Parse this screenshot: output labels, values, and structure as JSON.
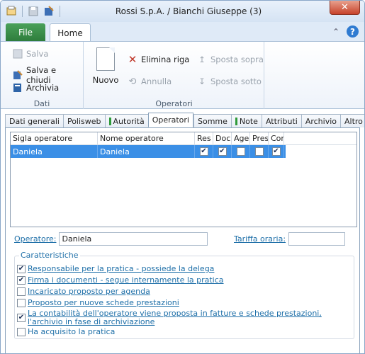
{
  "window": {
    "title": "Rossi S.p.A. / Bianchi Giuseppe (3)",
    "close_label": "✕"
  },
  "ribbon_tabs": {
    "file": "File",
    "home": "Home"
  },
  "ribbon": {
    "dati": {
      "label": "Dati",
      "salva": "Salva",
      "salva_chiudi": "Salva e chiudi",
      "archivia": "Archivia"
    },
    "operatori": {
      "label": "Operatori",
      "nuovo": "Nuovo",
      "elimina": "Elimina riga",
      "annulla": "Annulla",
      "sposta_sopra": "Sposta sopra",
      "sposta_sotto": "Sposta sotto"
    }
  },
  "tabs": [
    "Dati generali",
    "Polisweb",
    "Autorità",
    "Operatori",
    "Somme",
    "Note",
    "Attributi",
    "Archivio",
    "Altro"
  ],
  "grid": {
    "headers": [
      "Sigla operatore",
      "Nome operatore",
      "Res",
      "Doc",
      "Age",
      "Pres",
      "Con"
    ],
    "rows": [
      {
        "sigla": "Daniela",
        "nome": "Daniela",
        "checks": [
          true,
          true,
          false,
          false,
          true
        ]
      }
    ]
  },
  "form": {
    "operatore_label": "Operatore:",
    "operatore_value": "Daniela",
    "tariffa_label": "Tariffa oraria:",
    "tariffa_value": ""
  },
  "caratteristiche": {
    "legend": "Caratteristiche",
    "options": [
      {
        "label": "Responsabile per la pratica - possiede la delega",
        "checked": true
      },
      {
        "label": "Firma i documenti - segue internamente la pratica",
        "checked": true
      },
      {
        "label": "Incaricato proposto per agenda",
        "checked": false
      },
      {
        "label": "Proposto per nuove schede prestazioni",
        "checked": false
      },
      {
        "label": "La contabilità dell'operatore viene proposta in fatture e schede prestazioni, l'archivio in fase di archiviazione",
        "checked": true
      },
      {
        "label": "Ha acquisito la pratica",
        "checked": false
      }
    ]
  },
  "colors": {
    "accent": "#3b8fe6",
    "file_tab": "#2e7d3c",
    "link_text": "#1e6fa8"
  }
}
